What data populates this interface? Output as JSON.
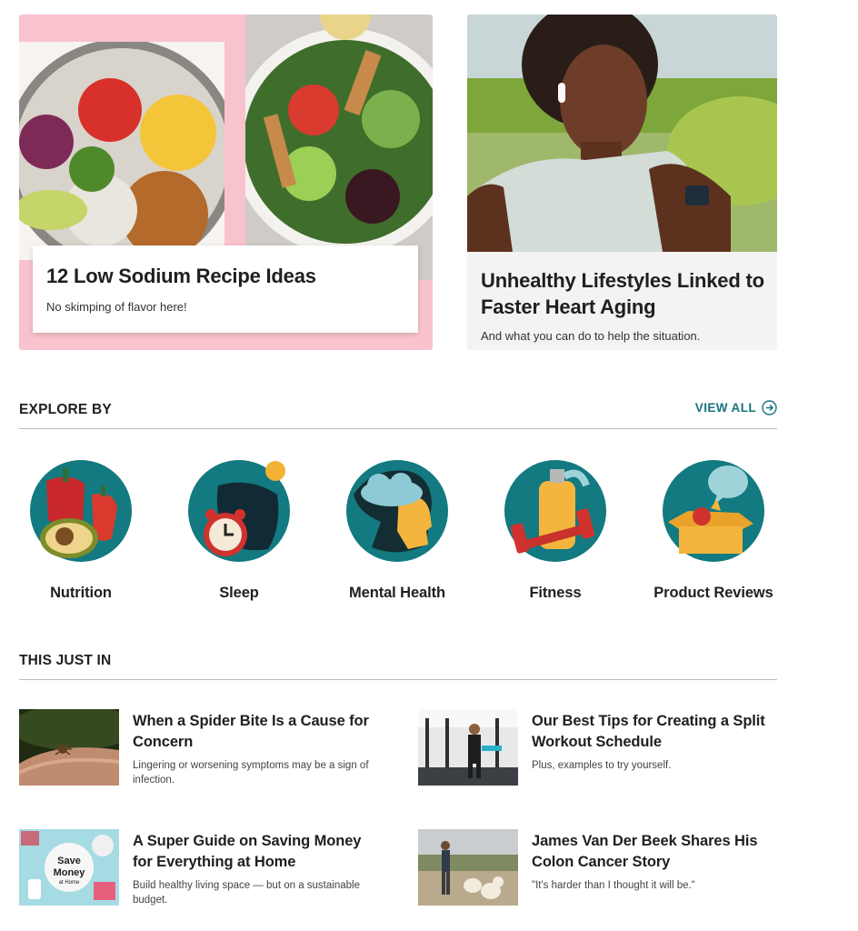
{
  "hero": [
    {
      "title": "12 Low Sodium Recipe Ideas",
      "subtitle": "No skimping of flavor here!"
    },
    {
      "title": "Unhealthy Lifestyles Linked to Faster Heart Aging",
      "subtitle": "And what you can do to help the situation."
    }
  ],
  "explore": {
    "title": "EXPLORE BY",
    "view_all": "VIEW ALL",
    "categories": [
      {
        "label": "Nutrition",
        "icon": "pepper-avocado-icon"
      },
      {
        "label": "Sleep",
        "icon": "alarm-clock-pillow-icon"
      },
      {
        "label": "Mental Health",
        "icon": "head-cloud-icon"
      },
      {
        "label": "Fitness",
        "icon": "dumbbell-bottle-icon"
      },
      {
        "label": "Product Reviews",
        "icon": "box-chat-bubble-icon"
      }
    ]
  },
  "latest": {
    "title": "THIS JUST IN",
    "articles": [
      {
        "title": "When a Spider Bite Is a Cause for Concern",
        "subtitle": "Lingering or worsening symptoms may be a sign of infection."
      },
      {
        "title": "Our Best Tips for Creating a Split Workout Schedule",
        "subtitle": "Plus, examples to try yourself."
      },
      {
        "title": "A Super Guide on Saving Money for Everything at Home",
        "subtitle": "Build healthy living space — but on a sustainable budget.",
        "thumb_text": "Save Money at Home"
      },
      {
        "title": "James Van Der Beek Shares His Colon Cancer Story",
        "subtitle": "\"It's harder than I thought it will be.\""
      }
    ]
  },
  "colors": {
    "accent": "#17727f",
    "teal_circle": "#127a80",
    "hero_pink": "#f9c3cd"
  }
}
